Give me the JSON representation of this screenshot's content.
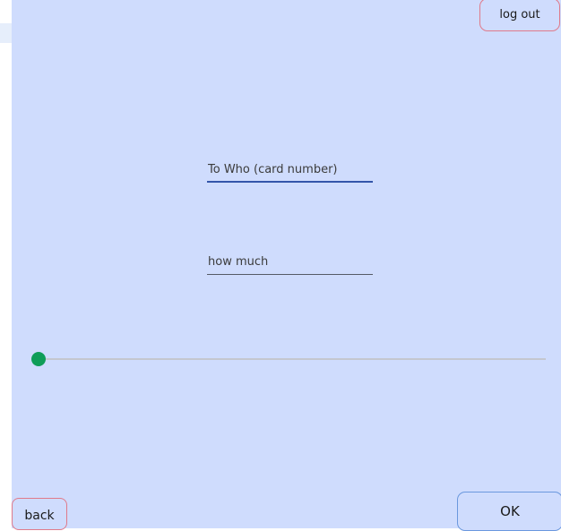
{
  "header": {
    "logout_label": "log out"
  },
  "form": {
    "recipient": {
      "placeholder": "To Who (card number)",
      "value": ""
    },
    "amount": {
      "placeholder": "how much",
      "value": ""
    },
    "slider": {
      "value_fraction": 0
    }
  },
  "footer": {
    "back_label": "back",
    "ok_label": "OK"
  },
  "colors": {
    "panel_background": "#cfdcfd",
    "accent_green": "#0f9d58",
    "active_underline": "#3355aa",
    "danger_border": "#e07a8a",
    "primary_border": "#6b98de"
  }
}
